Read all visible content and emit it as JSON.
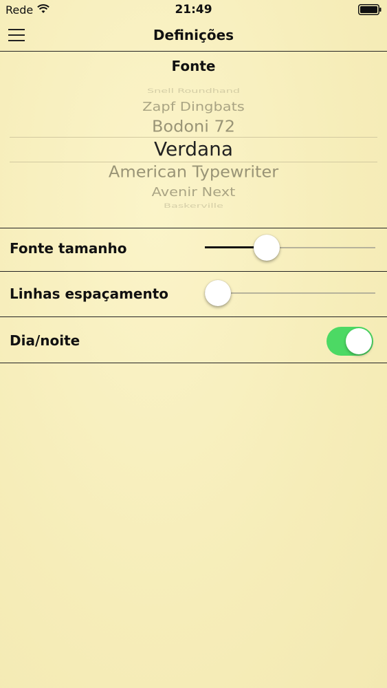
{
  "status_bar": {
    "carrier": "Rede",
    "time": "21:49",
    "wifi_icon": "wifi-icon",
    "battery_icon": "battery-icon"
  },
  "nav": {
    "title": "Definições",
    "menu_icon": "hamburger-menu-icon"
  },
  "font_section": {
    "title": "Fonte",
    "picker_items": [
      "Snell Roundhand",
      "Zapf Dingbats",
      "Bodoni 72",
      "Verdana",
      "American Typewriter",
      "Avenir Next",
      "Baskerville"
    ],
    "selected": "Verdana"
  },
  "font_size": {
    "label": "Fonte tamanho",
    "value": 0.34
  },
  "line_spacing": {
    "label": "Linhas espaçamento",
    "value": 0.0
  },
  "day_night": {
    "label": "Dia/noite",
    "on": true
  },
  "colors": {
    "background": "#f8f0bf",
    "toggle_on": "#4cd964"
  }
}
